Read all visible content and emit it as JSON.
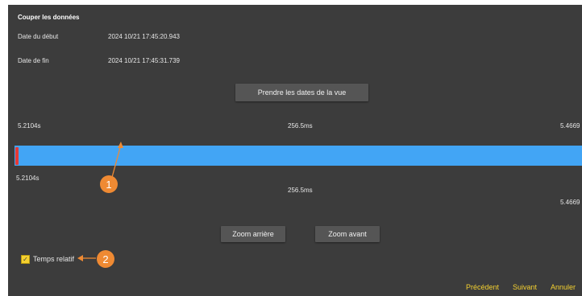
{
  "dialog": {
    "title": "Couper les données",
    "start_label": "Date du début",
    "start_value": "2024 10/21 17:45:20.943",
    "end_label": "Date de fin",
    "end_value": "2024 10/21 17:45:31.739",
    "take_view_dates_button": "Prendre les dates de la vue"
  },
  "timeline": {
    "top_start": "5.2104s",
    "top_duration": "256.5ms",
    "top_end": "5.4669",
    "bottom_start": "5.2104s",
    "bottom_duration": "256.5ms",
    "bottom_end": "5.4669",
    "bar_color": "#42a5f5",
    "handle_color": "#e53935"
  },
  "zoom": {
    "zoom_out": "Zoom arrière",
    "zoom_in": "Zoom avant"
  },
  "relative_time": {
    "label": "Temps relatif",
    "checked": true
  },
  "footer": {
    "previous": "Précédent",
    "next": "Suivant",
    "cancel": "Annuler"
  },
  "callouts": {
    "one": "1",
    "two": "2",
    "color": "#ef8a33"
  }
}
